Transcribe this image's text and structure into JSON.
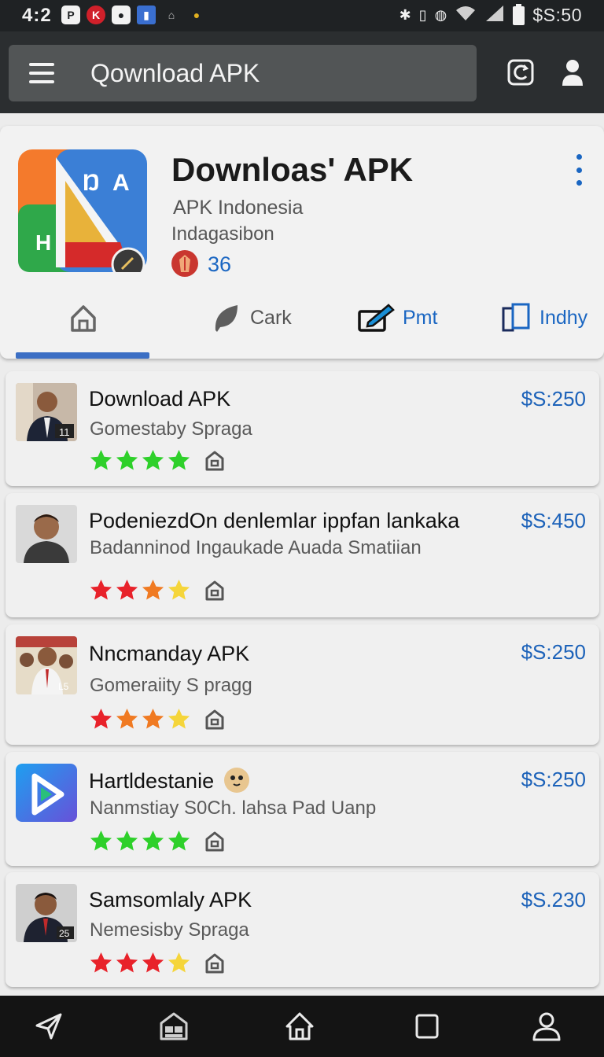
{
  "status_bar": {
    "time": "4:2",
    "clock": "$S:50",
    "notification_icons": [
      "p-icon",
      "k-icon",
      "camera-icon",
      "bookmark-icon",
      "home-icon",
      "warning-dot-icon"
    ],
    "system_icons": [
      "bluetooth-icon",
      "vibrate-icon",
      "alarm-icon",
      "wifi-icon",
      "signal-icon",
      "battery-icon"
    ]
  },
  "app_bar": {
    "search_placeholder": "Qownload APK",
    "icons": [
      "menu-icon",
      "reload-icon",
      "account-icon"
    ]
  },
  "header": {
    "title": "Downloas' APK",
    "subtitle": "APK Indonesia",
    "tagline": "Indagasibon",
    "rating_count": "36",
    "tabs": [
      {
        "label": "",
        "icon": "home-icon",
        "active": true
      },
      {
        "label": "Cark",
        "icon": "leaf-icon",
        "active": false
      },
      {
        "label": "Pmt",
        "icon": "edit-card-icon",
        "active": false
      },
      {
        "label": "Indhy",
        "icon": "panels-icon",
        "active": false
      }
    ]
  },
  "items": [
    {
      "title": "Download APK",
      "subtitle": "Gomestaby Spraga",
      "price": "$S:250",
      "rating": 4,
      "star_color": "#2ed02a",
      "thumb_badge": "11"
    },
    {
      "title": "PodeniezdOn denlemlar ippfan lankaka",
      "subtitle": "Badanninod Ingaukade Auada Smatiian",
      "price": "$S:450",
      "rating": 3.5,
      "star_color": "#e8222a",
      "thumb_badge": ""
    },
    {
      "title": "Nncmanday APK",
      "subtitle": "Gomeraiity S pragg",
      "price": "$S:250",
      "rating": 3.5,
      "star_color": "#e8222a",
      "thumb_badge": "L5"
    },
    {
      "title": "Hartldestanie",
      "subtitle": "Nanmstiay  S0Ch. lahsa Pad Uanp",
      "price": "$S:250",
      "rating": 4,
      "star_color": "#2ed02a",
      "thumb_badge": ""
    },
    {
      "title": "Samsomlaly APK",
      "subtitle": "Nemesisby Spraga",
      "price": "$S.230",
      "rating": 3.5,
      "star_color": "#e8222a",
      "thumb_badge": "25"
    }
  ],
  "colors": {
    "accent": "#1a66c2",
    "status_bar": "#1f2224",
    "app_bar": "#2b2e30",
    "star_green": "#2ed02a",
    "star_red": "#e8222a",
    "star_orange": "#f07a22",
    "star_yellow": "#f5d53a"
  },
  "bottom_nav": [
    "send-icon",
    "store-icon",
    "home-icon",
    "recents-icon",
    "profile-icon"
  ]
}
